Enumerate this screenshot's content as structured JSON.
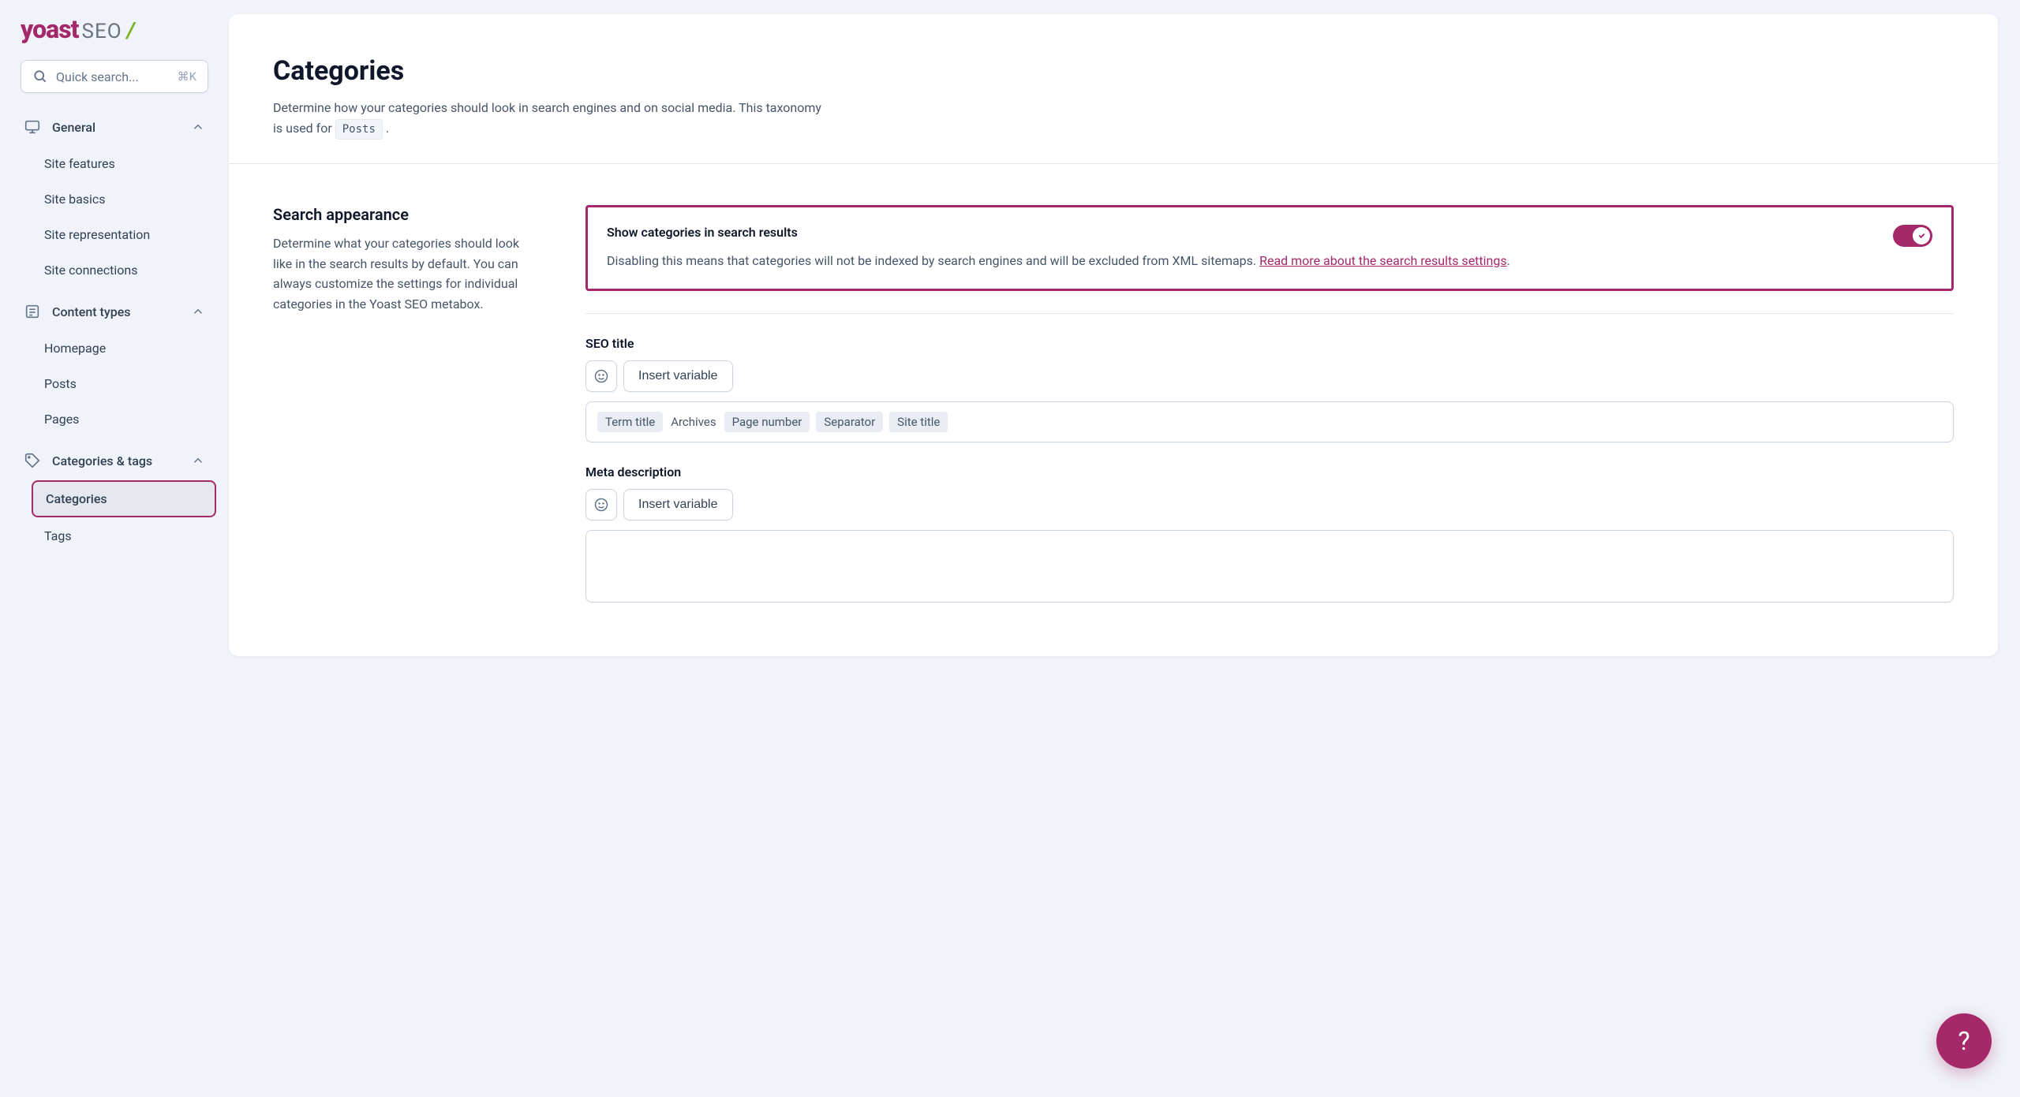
{
  "brand": {
    "name": "yoast",
    "suffix": "SEO",
    "slash": "/"
  },
  "search": {
    "placeholder": "Quick search...",
    "shortcut": "⌘K"
  },
  "sidebar": {
    "groups": [
      {
        "label": "General",
        "items": [
          {
            "label": "Site features"
          },
          {
            "label": "Site basics"
          },
          {
            "label": "Site representation"
          },
          {
            "label": "Site connections"
          }
        ]
      },
      {
        "label": "Content types",
        "items": [
          {
            "label": "Homepage"
          },
          {
            "label": "Posts"
          },
          {
            "label": "Pages"
          }
        ]
      },
      {
        "label": "Categories & tags",
        "items": [
          {
            "label": "Categories"
          },
          {
            "label": "Tags"
          }
        ]
      }
    ]
  },
  "page": {
    "title": "Categories",
    "description_pre": "Determine how your categories should look in search engines and on social media. This taxonomy is used for ",
    "description_code": "Posts",
    "description_post": " ."
  },
  "section_search_appearance": {
    "title": "Search appearance",
    "desc": "Determine what your categories should look like in the search results by default. You can always customize the settings for individual categories in the Yoast SEO metabox."
  },
  "card": {
    "label": "Show categories in search results",
    "text_pre": "Disabling this means that categories will not be indexed by search engines and will be excluded from XML sitemaps. ",
    "link": "Read more about the search results settings",
    "text_post": "."
  },
  "seo_title": {
    "label": "SEO title",
    "insert": "Insert variable",
    "tokens": [
      {
        "type": "chip",
        "text": "Term title"
      },
      {
        "type": "plain",
        "text": "Archives"
      },
      {
        "type": "chip",
        "text": "Page number"
      },
      {
        "type": "chip",
        "text": "Separator"
      },
      {
        "type": "chip",
        "text": "Site title"
      }
    ]
  },
  "meta_desc": {
    "label": "Meta description",
    "insert": "Insert variable"
  },
  "help": {
    "label": "?"
  }
}
